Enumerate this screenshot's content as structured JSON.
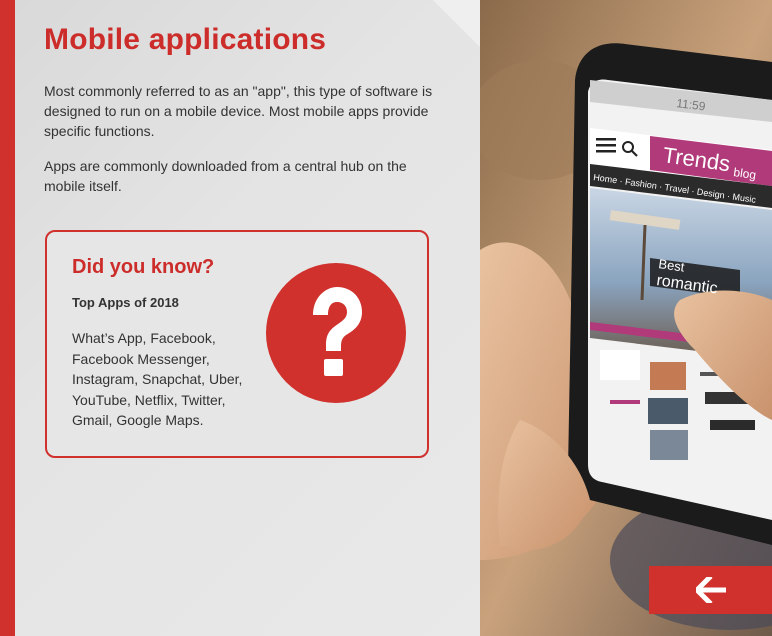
{
  "slide": {
    "title": "Mobile applications",
    "paragraphs": [
      "Most commonly referred to as an \"app\", this type of software is designed to run on a mobile device. Most mobile apps provide specific functions.",
      "Apps are commonly downloaded from a central hub on the mobile itself."
    ]
  },
  "callout": {
    "title": "Did you know?",
    "subtitle": "Top Apps of 2018",
    "apps_text": "What’s App, Facebook, Facebook Messenger, Instagram, Snapchat, Uber, YouTube, Netflix, Twitter, Gmail, Google Maps.",
    "icon": "question-mark-icon"
  },
  "photo": {
    "phone_time": "11:59",
    "blog_name": "Trends",
    "blog_suffix": "blog",
    "nav_text": "Home · Fashion · Travel · Design · Music",
    "banner_line1": "Best",
    "banner_line2": "romantic",
    "menu_icon": "hamburger-menu-icon",
    "search_icon": "search-icon"
  },
  "navigation": {
    "back_icon": "arrow-left-icon"
  },
  "colors": {
    "accent": "#d0312d",
    "text": "#333333",
    "background": "#e6e6e6",
    "blog_pink": "#b03a7a"
  }
}
